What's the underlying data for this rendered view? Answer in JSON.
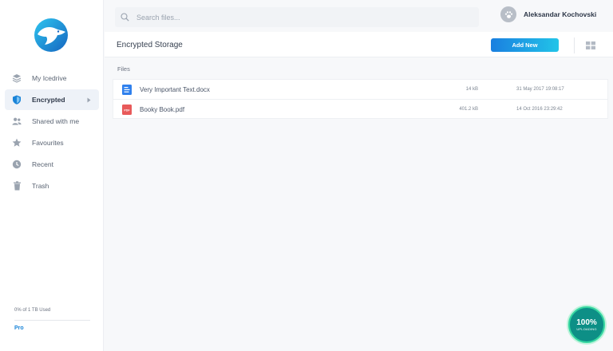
{
  "sidebar": {
    "items": [
      {
        "label": "My Icedrive",
        "icon": "layers-icon",
        "active": false
      },
      {
        "label": "Encrypted",
        "icon": "shield-icon",
        "active": true
      },
      {
        "label": "Shared with me",
        "icon": "users-icon",
        "active": false
      },
      {
        "label": "Favourites",
        "icon": "star-icon",
        "active": false
      },
      {
        "label": "Recent",
        "icon": "clock-icon",
        "active": false
      },
      {
        "label": "Trash",
        "icon": "trash-icon",
        "active": false
      }
    ],
    "usage": "0% of 1 TB Used",
    "plan": "Pro"
  },
  "search": {
    "placeholder": "Search files..."
  },
  "user": {
    "name": "Aleksandar Kochovski"
  },
  "header": {
    "title": "Encrypted Storage",
    "add_label": "Add New"
  },
  "files": {
    "section_label": "Files",
    "items": [
      {
        "name": "Very Important Text.docx",
        "size": "14 kB",
        "date": "31 May 2017 19:08:17",
        "type": "doc"
      },
      {
        "name": "Booky Book.pdf",
        "size": "401.2 kB",
        "date": "14 Oct 2016 23:29:42",
        "type": "pdf"
      }
    ]
  },
  "upload": {
    "percent": "100%",
    "label": "UPLOADING"
  },
  "colors": {
    "accent": "#1a84d8",
    "pdf": "#e85a5a",
    "doc": "#2f80ed",
    "upload": "#0d8f86"
  }
}
